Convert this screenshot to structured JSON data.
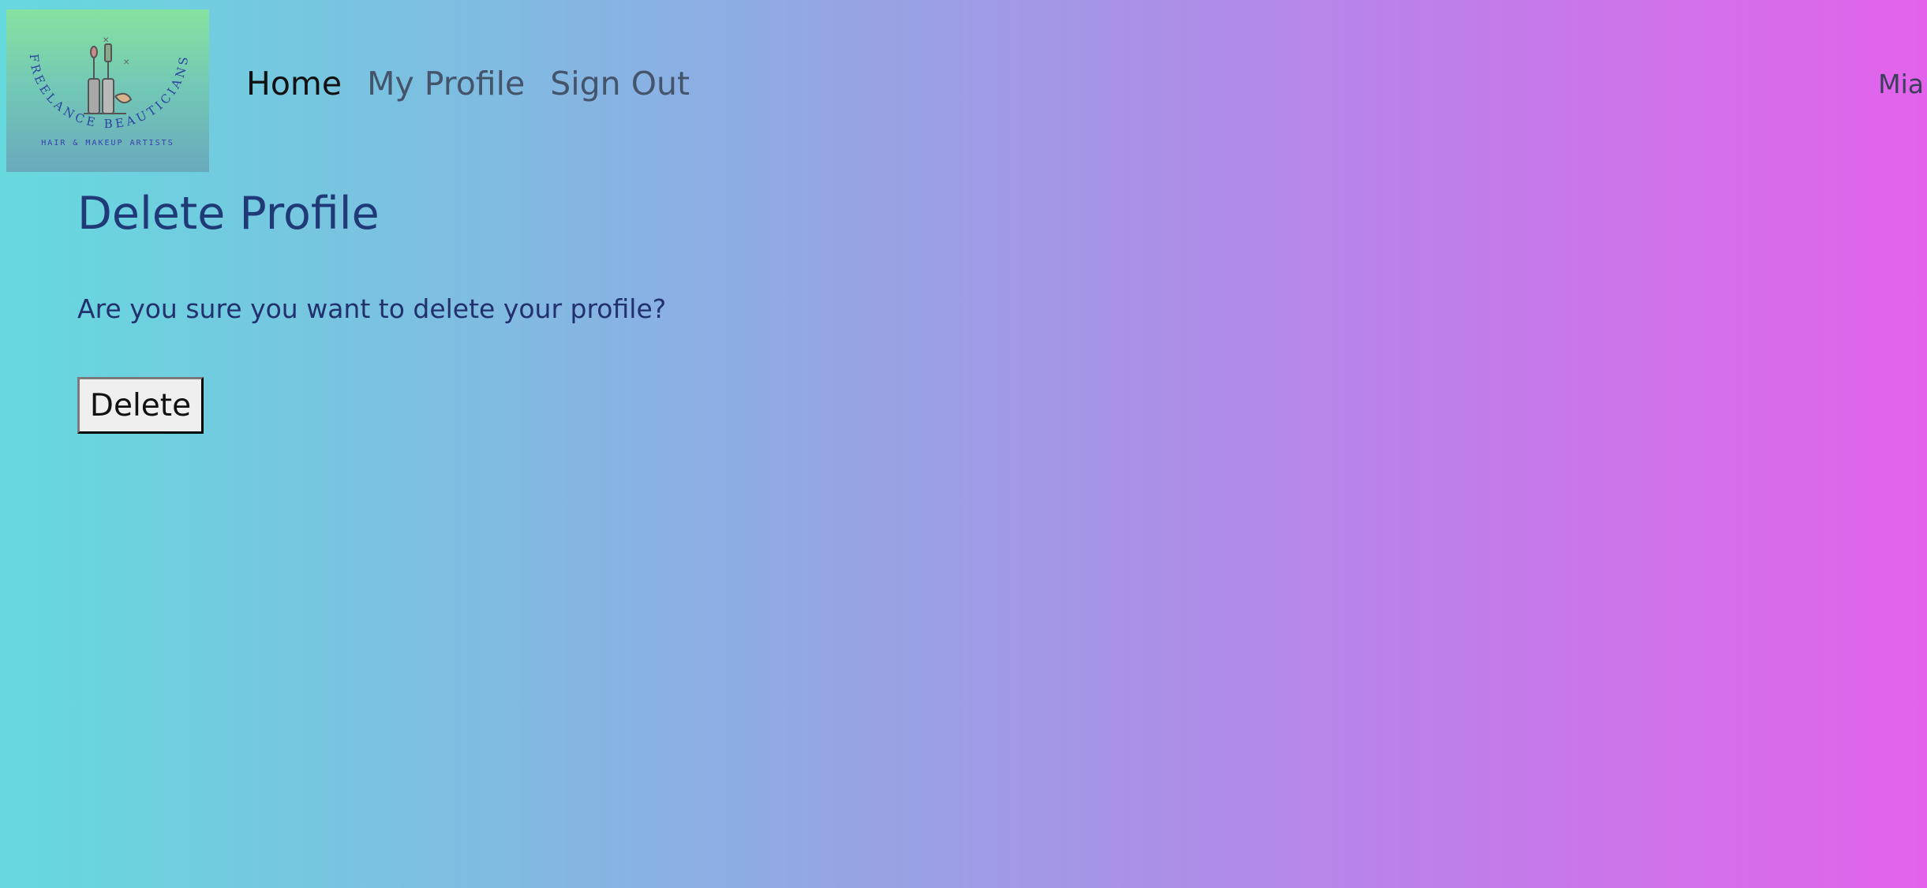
{
  "header": {
    "logo": {
      "arc_text": "FREELANCE BEAUTICIANS",
      "tagline": "HAIR & MAKEUP ARTISTS"
    },
    "nav": {
      "home_label": "Home",
      "profile_label": "My Profile",
      "signout_label": "Sign Out"
    },
    "user_name": "Mia"
  },
  "main": {
    "title": "Delete Profile",
    "confirm_text": "Are you sure you want to delete your profile?",
    "delete_label": "Delete"
  },
  "colors": {
    "title": "#203a78",
    "body_text": "#22306e",
    "nav_link": "#44546a",
    "nav_active": "#111111",
    "gradient_start": "#66d9de",
    "gradient_end": "#e362ec"
  }
}
